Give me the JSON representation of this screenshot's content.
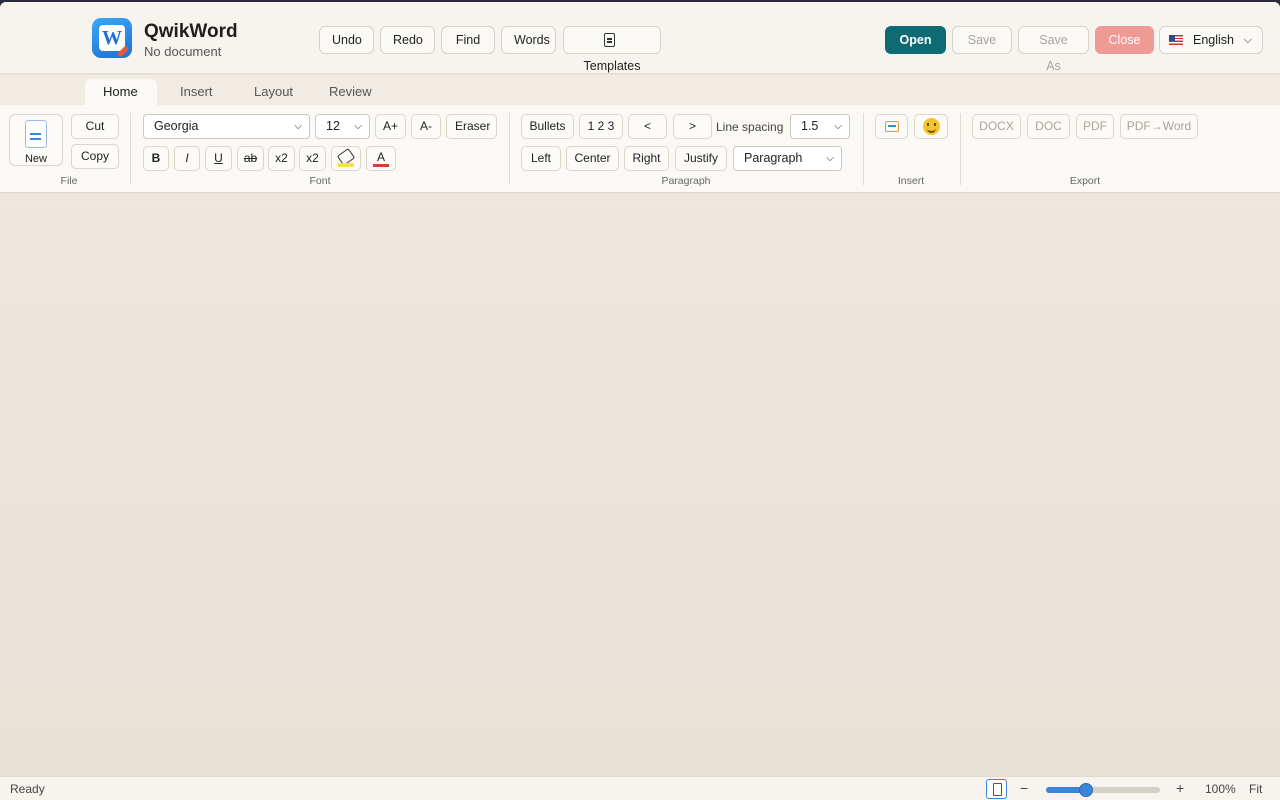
{
  "app": {
    "name": "QwikWord",
    "document_name": "No document",
    "logo_letter": "W"
  },
  "toolbar": {
    "undo": "Undo",
    "redo": "Redo",
    "find": "Find",
    "words": "Words",
    "templates": "Templates",
    "open": "Open",
    "save": "Save",
    "save_as": "Save As",
    "close": "Close",
    "language": "English",
    "colors": {
      "open": "#0f6b73",
      "close": "#ef9a94"
    }
  },
  "tabs": [
    "Home",
    "Insert",
    "Layout",
    "Review"
  ],
  "active_tab": "Home",
  "ribbon": {
    "file": {
      "label": "File",
      "new": "New",
      "cut": "Cut",
      "copy": "Copy"
    },
    "font": {
      "label": "Font",
      "family": "Georgia",
      "size": "12",
      "grow": "A+",
      "shrink": "A-",
      "eraser": "Eraser",
      "bold": "B",
      "italic": "I",
      "underline": "U",
      "strike": "ab",
      "superscript": "x2",
      "subscript": "x2",
      "font_color_glyph": "A",
      "highlight_color": "#f5e24a",
      "font_color": "#d73a3a"
    },
    "paragraph": {
      "label": "Paragraph",
      "bullets": "Bullets",
      "numbering": "1 2 3",
      "outdent": "<",
      "indent": ">",
      "line_spacing_label": "Line spacing",
      "line_spacing": "1.5",
      "left": "Left",
      "center": "Center",
      "right": "Right",
      "justify": "Justify",
      "style": "Paragraph"
    },
    "insert": {
      "label": "Insert"
    },
    "export": {
      "label": "Export",
      "docx": "DOCX",
      "doc": "DOC",
      "pdf": "PDF",
      "pdf_to_word": "PDF→Word"
    }
  },
  "status": {
    "text": "Ready",
    "zoom": "100%",
    "zoom_level": 0.35,
    "minus": "−",
    "plus": "+",
    "fit": "Fit"
  }
}
